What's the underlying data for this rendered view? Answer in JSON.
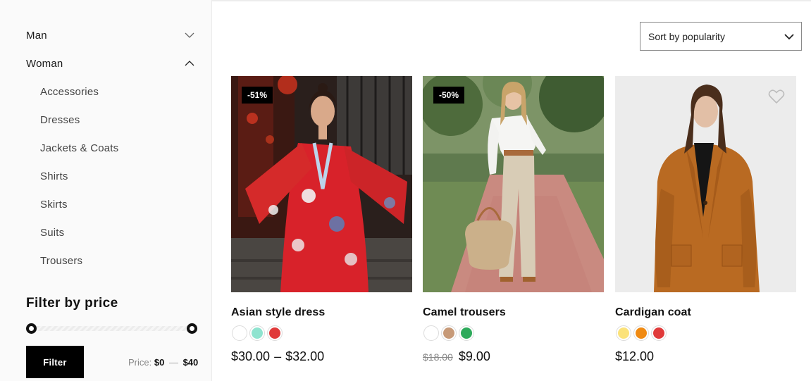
{
  "sidebar": {
    "categories": [
      {
        "label": "Man",
        "expanded": false
      },
      {
        "label": "Woman",
        "expanded": true
      }
    ],
    "woman_subcategories": [
      "Accessories",
      "Dresses",
      "Jackets & Coats",
      "Shirts",
      "Skirts",
      "Suits",
      "Trousers"
    ],
    "filter": {
      "title": "Filter by price",
      "button_label": "Filter",
      "price_prefix": "Price:",
      "min_value": "$0",
      "separator": "—",
      "max_value": "$40"
    }
  },
  "sort": {
    "selected": "Sort by popularity"
  },
  "products": [
    {
      "name": "Asian style dress",
      "badge": "-51%",
      "swatches": [
        "#ffffff",
        "#8fe3cf",
        "#e03a3a"
      ],
      "price_from": "$30.00",
      "price_separator": "–",
      "price_to": "$32.00"
    },
    {
      "name": "Camel trousers",
      "badge": "-50%",
      "swatches": [
        "#ffffff",
        "#c79a78",
        "#2eaa5b"
      ],
      "price_old": "$18.00",
      "price": "$9.00"
    },
    {
      "name": "Cardigan coat",
      "swatches": [
        "#fbe27a",
        "#f08a12",
        "#e03a3a"
      ],
      "price": "$12.00"
    }
  ]
}
